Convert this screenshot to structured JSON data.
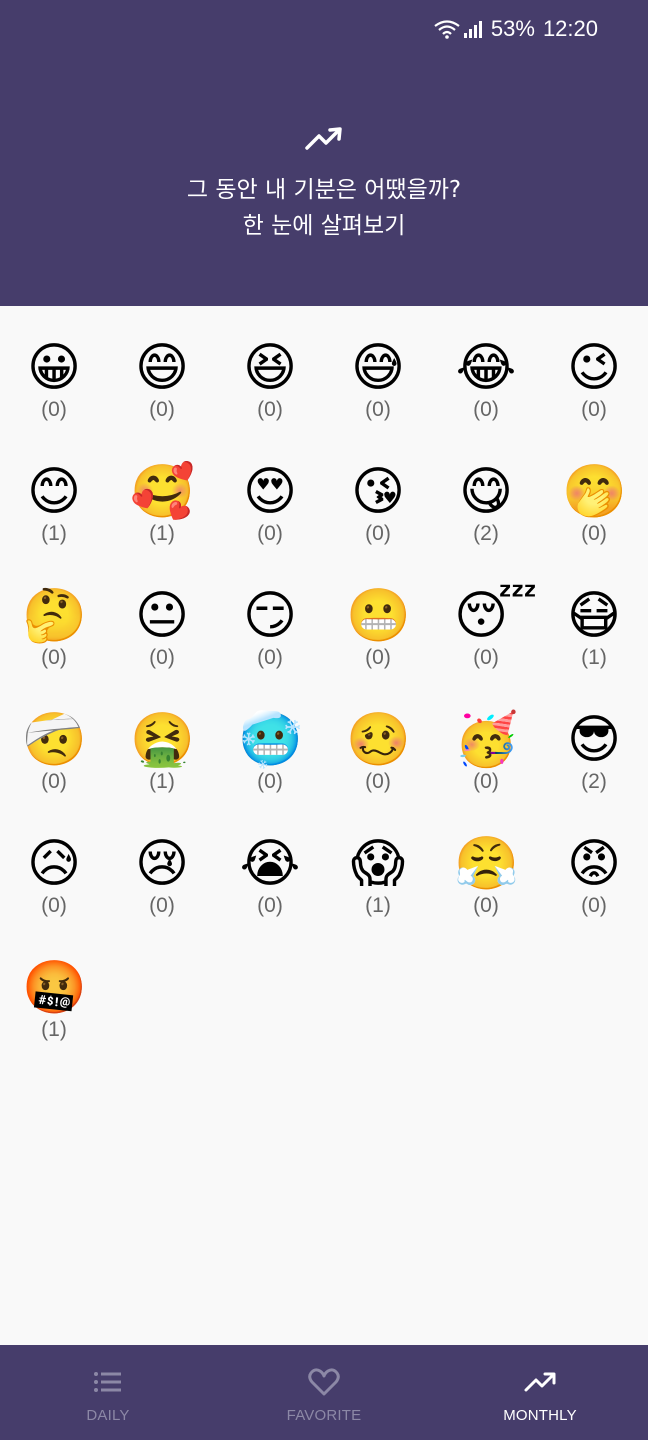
{
  "status_bar": {
    "battery": "53%",
    "time": "12:20",
    "icons": [
      "wifi-icon",
      "signal-icon"
    ]
  },
  "header": {
    "icon": "trending-up-icon",
    "title_line1": "그 동안 내 기분은 어땠을까?",
    "title_line2": "한 눈에 살펴보기"
  },
  "moods": [
    {
      "emoji": "😀",
      "count": "(0)"
    },
    {
      "emoji": "😄",
      "count": "(0)"
    },
    {
      "emoji": "😆",
      "count": "(0)"
    },
    {
      "emoji": "😅",
      "count": "(0)"
    },
    {
      "emoji": "😂",
      "count": "(0)"
    },
    {
      "emoji": "😉",
      "count": "(0)"
    },
    {
      "emoji": "😊",
      "count": "(1)"
    },
    {
      "emoji": "🥰",
      "count": "(1)"
    },
    {
      "emoji": "😍",
      "count": "(0)"
    },
    {
      "emoji": "😘",
      "count": "(0)"
    },
    {
      "emoji": "😋",
      "count": "(2)"
    },
    {
      "emoji": "🤭",
      "count": "(0)"
    },
    {
      "emoji": "🤔",
      "count": "(0)"
    },
    {
      "emoji": "😐",
      "count": "(0)"
    },
    {
      "emoji": "😏",
      "count": "(0)"
    },
    {
      "emoji": "😬",
      "count": "(0)"
    },
    {
      "emoji": "😴",
      "count": "(0)"
    },
    {
      "emoji": "😷",
      "count": "(1)"
    },
    {
      "emoji": "🤕",
      "count": "(0)"
    },
    {
      "emoji": "🤮",
      "count": "(1)"
    },
    {
      "emoji": "🥶",
      "count": "(0)"
    },
    {
      "emoji": "🥴",
      "count": "(0)"
    },
    {
      "emoji": "🥳",
      "count": "(0)"
    },
    {
      "emoji": "😎",
      "count": "(2)"
    },
    {
      "emoji": "😥",
      "count": "(0)"
    },
    {
      "emoji": "😢",
      "count": "(0)"
    },
    {
      "emoji": "😭",
      "count": "(0)"
    },
    {
      "emoji": "😱",
      "count": "(1)"
    },
    {
      "emoji": "😤",
      "count": "(0)"
    },
    {
      "emoji": "😡",
      "count": "(0)"
    },
    {
      "emoji": "🤬",
      "count": "(1)"
    }
  ],
  "bottom_nav": {
    "items": [
      {
        "label": "DAILY",
        "icon": "list-icon",
        "active": false
      },
      {
        "label": "FAVORITE",
        "icon": "heart-icon",
        "active": false
      },
      {
        "label": "MONTHLY",
        "icon": "trending-up-icon",
        "active": true
      }
    ]
  },
  "colors": {
    "header_bg": "#463d6b",
    "body_bg": "#f9f9f9",
    "count_text": "#666666",
    "nav_inactive": "#8c88a6",
    "nav_active": "#ffffff"
  }
}
